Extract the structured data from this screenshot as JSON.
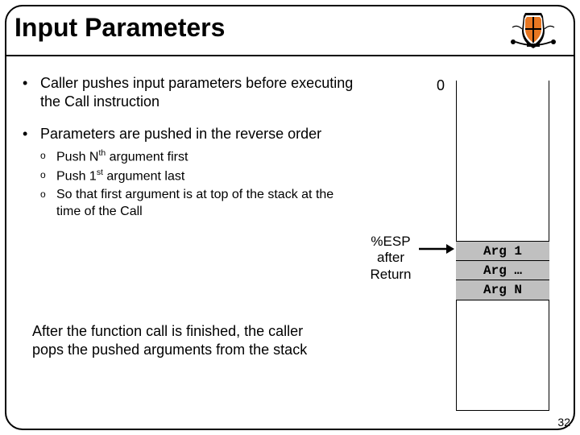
{
  "title": "Input Parameters",
  "bullets": {
    "b1": "Caller pushes input parameters before executing the Call instruction",
    "b2": "Parameters are pushed in the reverse order",
    "s1a": "Push N",
    "s1b": "th",
    "s1c": " argument first",
    "s2a": "Push 1",
    "s2b": "st",
    "s2c": " argument last",
    "s3": "So that first argument is at top of the stack at the time of the Call"
  },
  "after": "After the function call is finished, the caller pops the pushed arguments from the stack",
  "stack": {
    "zero": "0",
    "esp1": "%ESP",
    "esp2": "after",
    "esp3": "Return",
    "r1": "Arg 1",
    "r2": "Arg …",
    "r3": "Arg N"
  },
  "page": "32"
}
